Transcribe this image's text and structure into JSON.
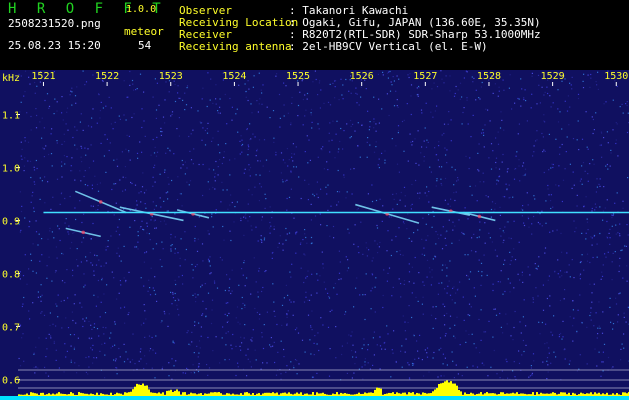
{
  "app": {
    "logo": "H R O F F T",
    "version": "1.0.0"
  },
  "file": {
    "name": "2508231520.png",
    "datetime": "25.08.23 15:20"
  },
  "meteor": {
    "label": "meteor",
    "count": "54"
  },
  "station": {
    "observer_label": "Observer",
    "observer_value": ": Takanori Kawachi",
    "location_label": "Receiving Location",
    "location_value": ": Ogaki, Gifu, JAPAN (136.60E, 35.35N)",
    "receiver_label": "Receiver",
    "receiver_value": ": R820T2(RTL-SDR) SDR-Sharp 53.1000MHz",
    "antenna_label": "Receiving antenna",
    "antenna_value": ": 2el-HB9CV Vertical (el. E-W)"
  },
  "chart_data": {
    "type": "heatmap",
    "ylabel": "kHz",
    "x_ticks": [
      "1521",
      "1522",
      "1523",
      "1524",
      "1525",
      "1526",
      "1527",
      "1528",
      "1529",
      "1530"
    ],
    "y_ticks": [
      "1.1",
      "1.0",
      "0.9",
      "0.8",
      "0.7",
      "0.6"
    ],
    "xlim": [
      1520.6,
      1530.2
    ],
    "ylim": [
      0.58,
      1.15
    ],
    "carrier_khz": 0.915,
    "colors": {
      "background": "#101060",
      "tick_text": "#ffff2a",
      "carrier": "#40e0ff",
      "level_bars": "#ffff00",
      "level_base": "#00e0ff"
    },
    "echoes": [
      {
        "x0": 1521.5,
        "y0": 0.955,
        "x1": 1522.3,
        "y1": 0.915
      },
      {
        "x0": 1522.2,
        "y0": 0.925,
        "x1": 1523.2,
        "y1": 0.9
      },
      {
        "x0": 1521.35,
        "y0": 0.885,
        "x1": 1521.9,
        "y1": 0.87
      },
      {
        "x0": 1523.1,
        "y0": 0.92,
        "x1": 1523.6,
        "y1": 0.905
      },
      {
        "x0": 1525.9,
        "y0": 0.93,
        "x1": 1526.9,
        "y1": 0.895
      },
      {
        "x0": 1527.1,
        "y0": 0.925,
        "x1": 1527.7,
        "y1": 0.91
      },
      {
        "x0": 1527.6,
        "y0": 0.915,
        "x1": 1528.1,
        "y1": 0.9
      }
    ]
  }
}
